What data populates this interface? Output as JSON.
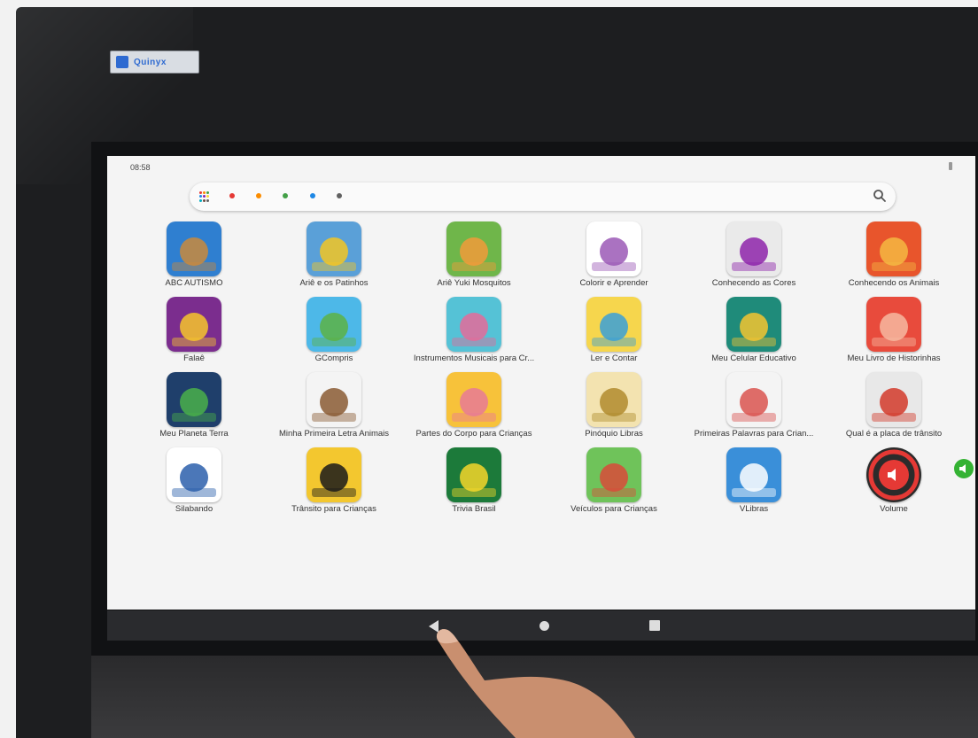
{
  "device": {
    "brand_text": "Quinyx",
    "status_time": "08:58"
  },
  "search": {
    "dot_colors": [
      "#e53935",
      "#fb8c00",
      "#43a047",
      "#1e88e5",
      "#616161"
    ]
  },
  "apps": [
    {
      "label": "ABC AUTISMO",
      "bg": "#2f7fd0",
      "accent": "#c98a3c"
    },
    {
      "label": "Ariê e os Patinhos",
      "bg": "#5aa0d8",
      "accent": "#f3c623"
    },
    {
      "label": "Ariê Yuki Mosquitos",
      "bg": "#6fb64a",
      "accent": "#f29b3a"
    },
    {
      "label": "Colorir e Aprender",
      "bg": "#ffffff",
      "accent": "#9b59b6"
    },
    {
      "label": "Conhecendo as Cores",
      "bg": "#eaeaea",
      "accent": "#8e24aa"
    },
    {
      "label": "Conhecendo os Animais",
      "bg": "#e8552c",
      "accent": "#f4b942"
    },
    {
      "label": "Falaê",
      "bg": "#7b2d8e",
      "accent": "#f7c52c"
    },
    {
      "label": "GCompris",
      "bg": "#4db8e8",
      "accent": "#5db244"
    },
    {
      "label": "Instrumentos Musicais para Cr...",
      "bg": "#55c2d6",
      "accent": "#e56b9a"
    },
    {
      "label": "Ler e Contar",
      "bg": "#f6d64d",
      "accent": "#3aa0d8"
    },
    {
      "label": "Meu Celular Educativo",
      "bg": "#1f8b7a",
      "accent": "#f4c430"
    },
    {
      "label": "Meu Livro de Historinhas",
      "bg": "#e84b3c",
      "accent": "#f6b9a0"
    },
    {
      "label": "Meu Planeta Terra",
      "bg": "#1f3f6b",
      "accent": "#4ab04a"
    },
    {
      "label": "Minha Primeira Letra Animais",
      "bg": "#f4f4f4",
      "accent": "#8a5a32"
    },
    {
      "label": "Partes do Corpo para Crianças",
      "bg": "#f7c23a",
      "accent": "#e87a96"
    },
    {
      "label": "Pinóquio Libras",
      "bg": "#f3e3b0",
      "accent": "#b08b2e"
    },
    {
      "label": "Primeiras Palavras para Crian...",
      "bg": "#f4f4f4",
      "accent": "#d9534f"
    },
    {
      "label": "Qual é a placa de trânsito",
      "bg": "#e8e8e8",
      "accent": "#d23a2a"
    },
    {
      "label": "Silabando",
      "bg": "#ffffff",
      "accent": "#2b5fab"
    },
    {
      "label": "Trânsito para Crianças",
      "bg": "#f3c72f",
      "accent": "#1a1a1a"
    },
    {
      "label": "Trivia Brasil",
      "bg": "#1c7a3a",
      "accent": "#f5d62a"
    },
    {
      "label": "Veículos para Crianças",
      "bg": "#6fc35a",
      "accent": "#d94b3a"
    },
    {
      "label": "VLibras",
      "bg": "#3a8fd9",
      "accent": "#ffffff"
    },
    {
      "label": "Volume",
      "bg": "#2b2b2b",
      "accent": "#e53935"
    }
  ]
}
